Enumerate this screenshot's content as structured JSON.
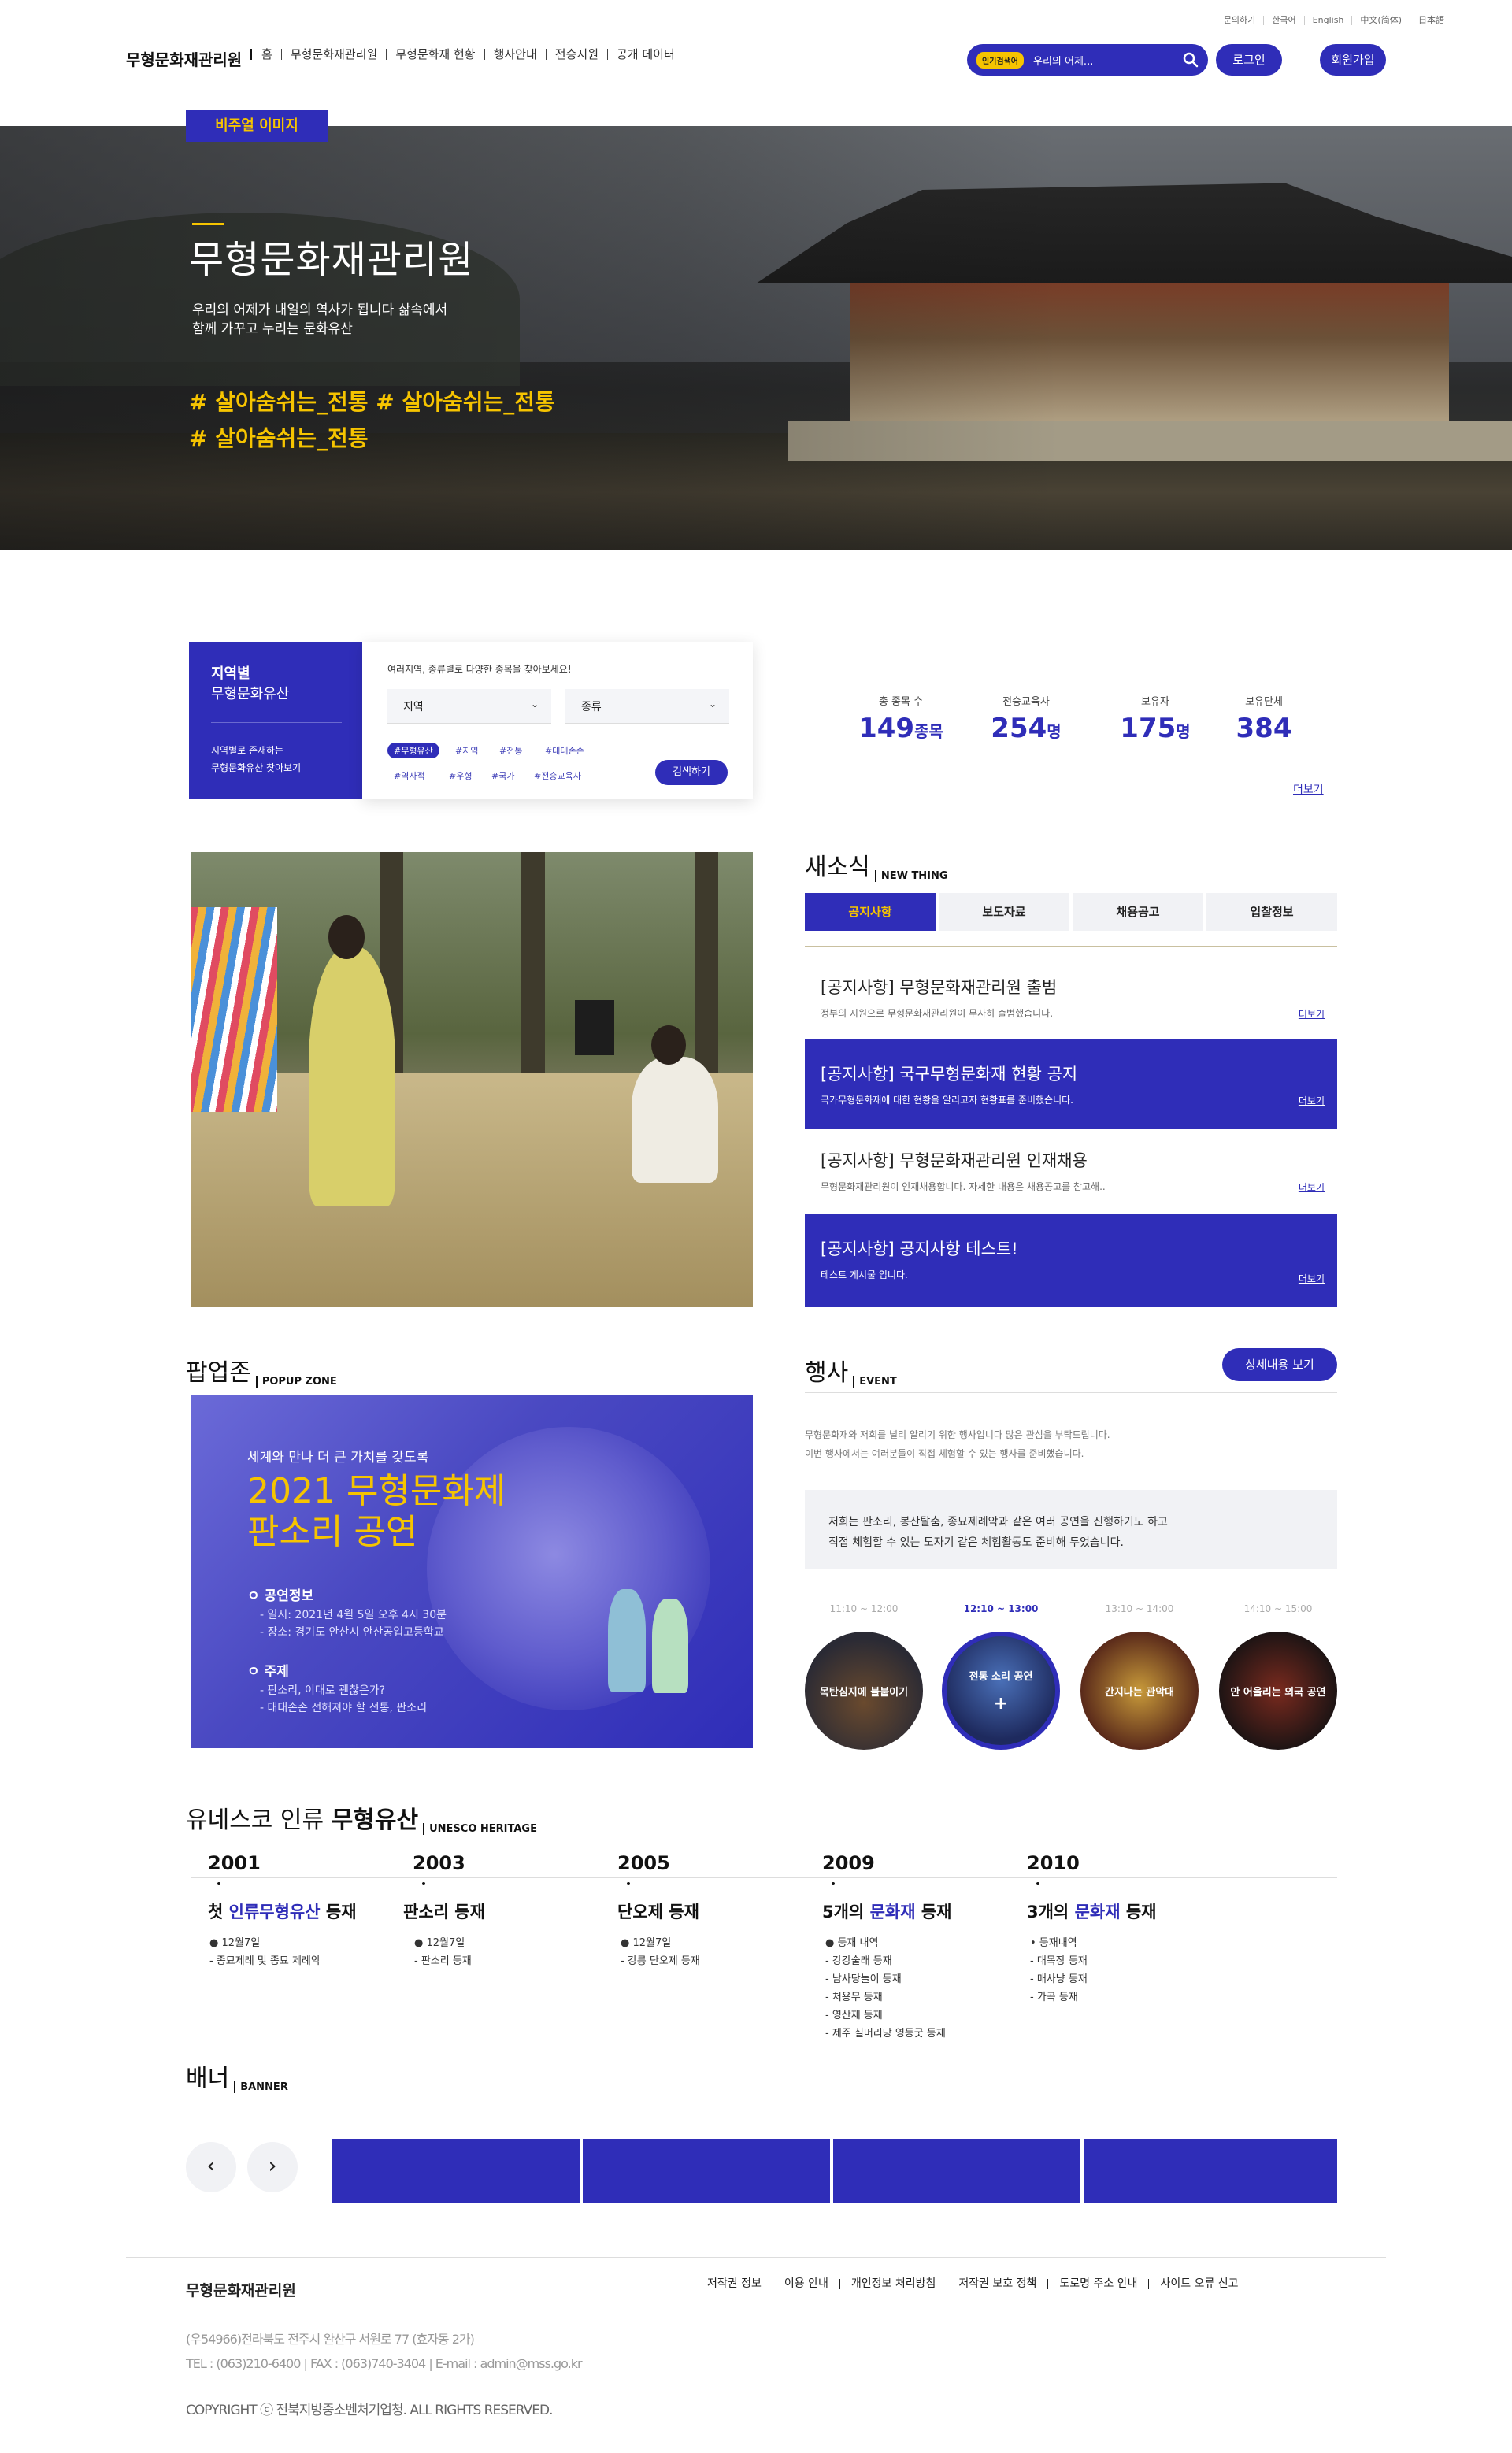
{
  "util_links": [
    "문의하기",
    "한국어",
    "English",
    "中文(简体)",
    "日本語"
  ],
  "header": {
    "logo": "무형문화재관리원",
    "nav": [
      "홈",
      "무형문화재관리원",
      "무형문화재 현황",
      "행사안내",
      "전승지원",
      "공개 데이터"
    ],
    "search_tag": "인기검색어",
    "search_value": "우리의 어제...",
    "login": "로그인",
    "signup": "회원가입"
  },
  "hero": {
    "badge": "비주얼 이미지",
    "title": "무형문화재관리원",
    "sub_line1": "우리의 어제가 내일의 역사가 됩니다 삶속에서",
    "sub_line2": "함께 가꾸고 누리는 문화유산",
    "tag_line1": "# 살아숨쉬는_전통  # 살아숨쉬는_전통",
    "tag_line2": "# 살아숨쉬는_전통"
  },
  "region": {
    "title1": "지역별",
    "title2": "무형문화유산",
    "desc1": "지역별로 존재하는",
    "desc2": "무형문화유산 찾아보기"
  },
  "filter": {
    "hint": "여러지역, 종류별로 다양한 종목을 찾아보세요!",
    "select_region": "지역",
    "select_type": "종류",
    "chips_row1": [
      "#무형유산",
      "#지역",
      "#전통",
      "#대대손손"
    ],
    "chips_row2": [
      "#역사적",
      "#우형",
      "#국가",
      "#전승교육사"
    ],
    "search_button": "검색하기"
  },
  "stats": [
    {
      "label": "총 종목 수",
      "value": "149",
      "unit": "종목"
    },
    {
      "label": "전승교육사",
      "value": "254",
      "unit": "명"
    },
    {
      "label": "보유자",
      "value": "175",
      "unit": "명"
    },
    {
      "label": "보유단체",
      "value": "384",
      "unit": ""
    }
  ],
  "stats_more": "더보기",
  "news": {
    "title": "새소식",
    "title_en": "NEW THING",
    "tabs": [
      "공지사항",
      "보도자료",
      "채용공고",
      "입찰정보"
    ],
    "items": [
      {
        "title": "[공지사항] 무형문화재관리원 출범",
        "desc": "정부의 지원으로 무형문화재관리원이 무사히 출범했습니다.",
        "more": "더보기"
      },
      {
        "title": "[공지사항] 국구무형문화재 현황 공지",
        "desc": "국가무형문화재에 대한 현황을 알리고자 현황표를 준비했습니다.",
        "more": "더보기"
      },
      {
        "title": "[공지사항] 무형문화재관리원 인재채용",
        "desc": "무형문화재관리원이 인재채용합니다. 자세한 내용은 채용공고를 참고해..",
        "more": "더보기"
      },
      {
        "title": "[공지사항] 공지사항 테스트!",
        "desc": "테스트 게시물 입니다.",
        "more": "더보기"
      }
    ]
  },
  "popup": {
    "title": "팝업존",
    "title_en": "POPUP ZONE",
    "line1": "세계와 만나 더 큰 가치를 갖도록",
    "line2a": "2021 무형문화제",
    "line2b": "판소리 공연",
    "info_title": "ㅇ 공연정보",
    "info1": "- 일시: 2021년 4월 5일 오후 4시 30분",
    "info2": "- 장소: 경기도 안산시 안산공업고등학교",
    "theme_title": "ㅇ 주제",
    "theme1": "- 판소리, 이대로 괜찮은가?",
    "theme2": "- 대대손손 전해져야 할 전통, 판소리"
  },
  "event": {
    "title": "행사",
    "title_en": "EVENT",
    "detail_button": "상세내용 보기",
    "desc1": "무형문화재와 저희를 널리 알리기 위한 행사입니다 많은 관심을 부탁드립니다.",
    "desc2": "이번 행사에서는 여러분들이 직접 체험할 수 있는 행사를 준비했습니다.",
    "box1": "저희는 판소리, 봉산탈춤, 종묘제례악과 같은 여러 공연을 진행하기도 하고",
    "box2": "직접 체험할 수 있는 도자기 같은 체험활동도 준비해 두었습니다.",
    "slots": [
      {
        "time": "11:10 ~ 12:00",
        "label": "목탄심지에 불붙이기"
      },
      {
        "time": "12:10 ~ 13:00",
        "label": "전통 소리 공연"
      },
      {
        "time": "13:10 ~ 14:00",
        "label": "간지나는 관악대"
      },
      {
        "time": "14:10 ~ 15:00",
        "label": "안 어울리는 외국 공연"
      }
    ],
    "active_plus": "+"
  },
  "unesco": {
    "title_a": "유네스코 인류 ",
    "title_b": "무형유산",
    "title_en": "UNESCO HERITAGE",
    "items": [
      {
        "year": "2001",
        "t_pre": "첫 ",
        "t_em": "인류무형유산",
        "t_post": " 등재",
        "lines": [
          "● 12월7일",
          "- 종묘제례 및 종묘 제례악"
        ]
      },
      {
        "year": "2003",
        "t_pre": "판소리 등재",
        "t_em": "",
        "t_post": "",
        "lines": [
          "● 12월7일",
          "- 판소리 등재"
        ]
      },
      {
        "year": "2005",
        "t_pre": "단오제 등재",
        "t_em": "",
        "t_post": "",
        "lines": [
          "● 12월7일",
          "- 강릉 단오제 등재"
        ]
      },
      {
        "year": "2009",
        "t_pre": "5개의 ",
        "t_em": "문화재",
        "t_post": " 등재",
        "lines": [
          "● 등재 내역",
          "- 강강술래 등재",
          "- 남사당놀이 등재",
          "- 처용무 등재",
          "- 영산재 등재",
          "- 제주 칠머리당 영등굿 등재"
        ]
      },
      {
        "year": "2010",
        "t_pre": "3개의 ",
        "t_em": "문화재",
        "t_post": " 등재",
        "lines": [
          "• 등재내역",
          "- 대목장 등재",
          "- 매사냥 등재",
          "- 가곡 등재"
        ]
      }
    ]
  },
  "banner": {
    "title": "배너",
    "title_en": "BANNER",
    "prev": "‹",
    "next": "›"
  },
  "footer": {
    "logo": "무형문화재관리원",
    "links": [
      "저작권 정보",
      "이용 안내",
      "개인정보 처리방침",
      "저작권 보호 정책",
      "도로명 주소 안내",
      "사이트 오류 신고"
    ],
    "addr1": "(우54966)전라북도 전주시 완산구 서원로 77 (효자동 2가)",
    "addr2": "TEL : (063)210-6400   |   FAX : (063)740-3404   |   E-mail : admin@mss.go.kr",
    "copyright": "COPYRIGHT ⓒ 전북지방중소벤처기업청. ALL RIGHTS RESERVED."
  },
  "colors": {
    "primary": "#2f2db8",
    "accent": "#f6c400"
  }
}
